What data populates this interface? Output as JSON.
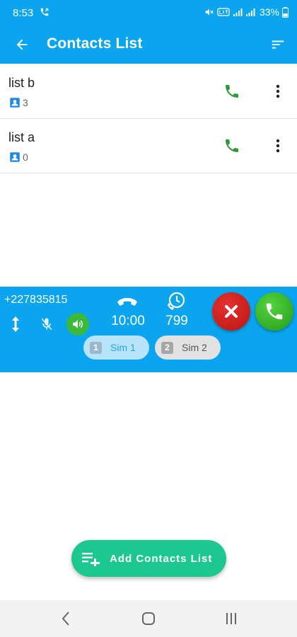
{
  "status_bar": {
    "time": "8:53",
    "battery": "33%",
    "icons": [
      "call-forward-icon",
      "mute-icon",
      "volte-icon",
      "signal-icon",
      "signal-icon",
      "battery-icon"
    ]
  },
  "app_bar": {
    "title": "Contacts List",
    "back_icon": "arrow-left-icon",
    "sort_icon": "sort-icon"
  },
  "lists": [
    {
      "name": "list b",
      "count": "3"
    },
    {
      "name": "list a",
      "count": "0"
    }
  ],
  "call_panel": {
    "number": "+227835815",
    "duration": "10:00",
    "count": "799",
    "sims": [
      {
        "badge": "1",
        "label": "Sim 1",
        "selected": true
      },
      {
        "badge": "2",
        "label": "Sim 2",
        "selected": false
      }
    ]
  },
  "add_button": {
    "label": "Add Contacts List"
  },
  "colors": {
    "primary": "#0aa5ee",
    "call_green": "#2e9b3a",
    "fab_green": "#1dc890",
    "end_red": "#d42424"
  }
}
